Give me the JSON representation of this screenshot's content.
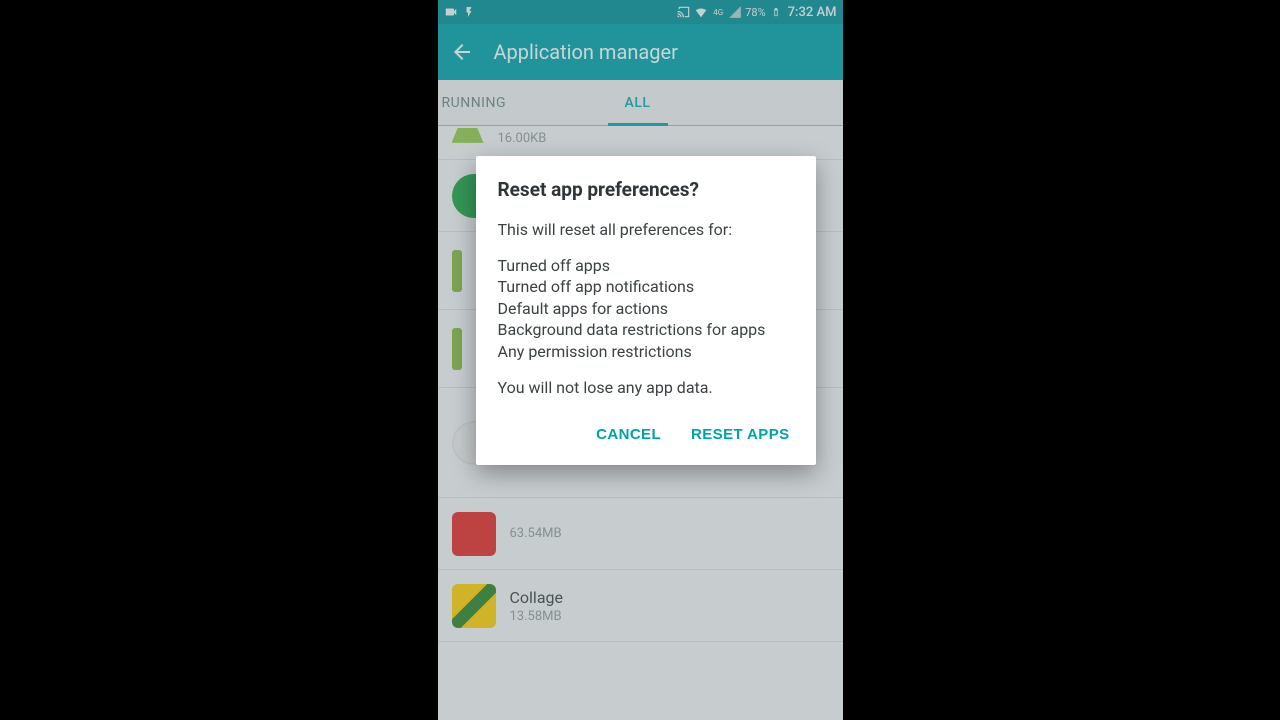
{
  "status": {
    "battery_pct": "78%",
    "time": "7:32 AM"
  },
  "toolbar": {
    "title": "Application manager"
  },
  "tabs": {
    "running": "RUNNING",
    "all": "ALL"
  },
  "apps": {
    "first_size": "16.00KB",
    "row5_size": "63.54MB",
    "row6_name": "Collage",
    "row6_size": "13.58MB"
  },
  "dialog": {
    "title": "Reset app preferences?",
    "intro": "This will reset all preferences for:",
    "item1": "Turned off apps",
    "item2": "Turned off app notifications",
    "item3": "Default apps for actions",
    "item4": "Background data restrictions for apps",
    "item5": "Any permission restrictions",
    "footer": "You will not lose any app data.",
    "cancel": "CANCEL",
    "confirm": "RESET APPS"
  }
}
